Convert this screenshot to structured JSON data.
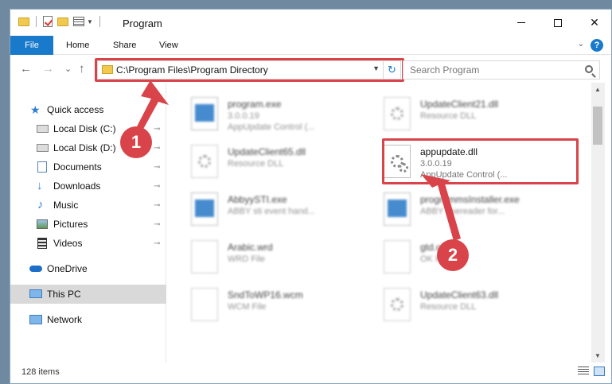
{
  "window": {
    "title": "Program",
    "close_glyph": "✕"
  },
  "ribbon": {
    "tabs": [
      "File",
      "Home",
      "Share",
      "View"
    ],
    "help_label": "?"
  },
  "navigation": {
    "back_glyph": "←",
    "forward_glyph": "→",
    "recent_glyph": "⌄",
    "up_glyph": "↑",
    "address": "C:\\Program Files\\Program Directory",
    "refresh_glyph": "↻",
    "search_placeholder": "Search Program"
  },
  "sidebar": {
    "items": [
      {
        "label": "Quick access",
        "icon": "star-icon"
      },
      {
        "label": "Local Disk (C:)",
        "icon": "disk-icon"
      },
      {
        "label": "Local Disk (D:)",
        "icon": "disk-icon"
      },
      {
        "label": "Documents",
        "icon": "documents-icon"
      },
      {
        "label": "Downloads",
        "icon": "download-icon"
      },
      {
        "label": "Music",
        "icon": "music-icon"
      },
      {
        "label": "Pictures",
        "icon": "pictures-icon"
      },
      {
        "label": "Videos",
        "icon": "videos-icon"
      },
      {
        "label": "OneDrive",
        "icon": "cloud-icon"
      },
      {
        "label": "This PC",
        "icon": "computer-icon"
      },
      {
        "label": "Network",
        "icon": "network-icon"
      }
    ],
    "pin_glyph": "📌"
  },
  "files": [
    {
      "name": "program.exe",
      "line1": "3.0.0.19",
      "line2": "AppUpdate Control (..."
    },
    {
      "name": "UpdateClient21.dll",
      "line1": "Resource DLL",
      "line2": ""
    },
    {
      "name": "UpdateClient65.dll",
      "line1": "Resource DLL",
      "line2": ""
    },
    {
      "name": "appupdate.dll",
      "line1": "3.0.0.19",
      "line2": "AppUpdate Control (..."
    },
    {
      "name": "AbbyySTI.exe",
      "line1": "ABBY sti event hand...",
      "line2": ""
    },
    {
      "name": "programmsInstaller.exe",
      "line1": "ABBY finereader for...",
      "line2": ""
    },
    {
      "name": "Arabic.wrd",
      "line1": "WRD File",
      "line2": ""
    },
    {
      "name": "gtd.ok",
      "line1": "OK File",
      "line2": ""
    },
    {
      "name": "SndToWP16.wcm",
      "line1": "WCM File",
      "line2": ""
    },
    {
      "name": "UpdateClient63.dll",
      "line1": "Resource DLL",
      "line2": ""
    }
  ],
  "status": {
    "item_count": "128 items"
  },
  "annotations": {
    "step1": "1",
    "step2": "2",
    "color": "#d9444a"
  }
}
